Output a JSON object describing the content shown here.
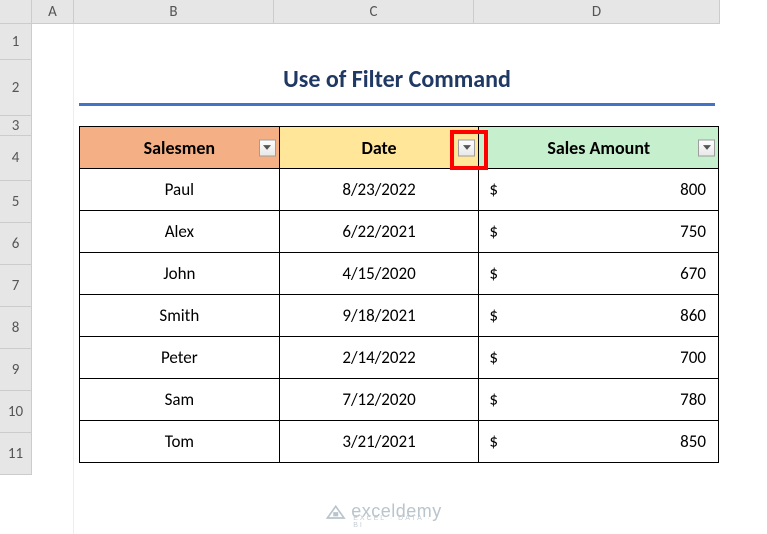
{
  "columns": [
    "A",
    "B",
    "C",
    "D"
  ],
  "rows": [
    "1",
    "2",
    "3",
    "4",
    "5",
    "6",
    "7",
    "8",
    "9",
    "10",
    "11"
  ],
  "title": "Use of Filter Command",
  "headers": {
    "salesmen": "Salesmen",
    "date": "Date",
    "amount": "Sales Amount"
  },
  "currency": "$",
  "data": [
    {
      "name": "Paul",
      "date": "8/23/2022",
      "amount": "800"
    },
    {
      "name": "Alex",
      "date": "6/22/2021",
      "amount": "750"
    },
    {
      "name": "John",
      "date": "4/15/2020",
      "amount": "670"
    },
    {
      "name": "Smith",
      "date": "9/18/2021",
      "amount": "860"
    },
    {
      "name": "Peter",
      "date": "2/14/2022",
      "amount": "700"
    },
    {
      "name": "Sam",
      "date": "7/12/2020",
      "amount": "780"
    },
    {
      "name": "Tom",
      "date": "3/21/2021",
      "amount": "850"
    }
  ],
  "watermark": {
    "brand": "exceldemy",
    "tag": "EXCEL · DATA · BI"
  }
}
